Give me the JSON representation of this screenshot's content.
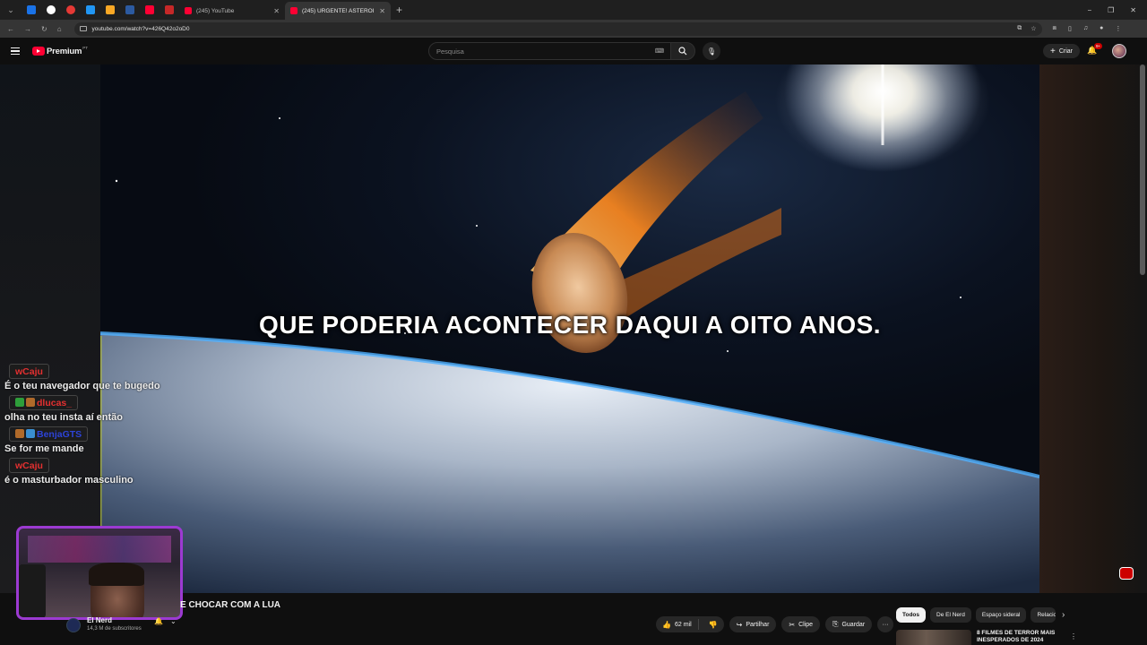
{
  "browser": {
    "tabs": [
      {
        "title": "(245) YouTube",
        "active": false
      },
      {
        "title": "(245) URGENTE! ASTERÓIDE V...",
        "active": true
      }
    ],
    "new_tab_icon": "plus-icon",
    "window_controls": [
      "−",
      "❐",
      "✕"
    ],
    "url": "youtube.com/watch?v=426Q42o2oD0",
    "pinned_colors": [
      "#1a73e8",
      "#ffffff",
      "#e53935",
      "#2196f3",
      "#f9a825",
      "#2c5aa0",
      "#ff0033",
      "#c62828"
    ]
  },
  "masthead": {
    "logo_text": "Premium",
    "country_code": "PT",
    "search_placeholder": "Pesquisa",
    "create_label": "Criar",
    "notifications_badge": "9+"
  },
  "video": {
    "subtitle": "QUE PODERIA ACONTECER DAQUI A OITO ANOS.",
    "title_partial": "E CHOCAR COM A LUA",
    "channel_name": "El Nerd",
    "subscribers": "14,3 M de subscritores"
  },
  "chat": [
    {
      "user": "wCaju",
      "color": "#e43030",
      "message": "É o teu navegador que te bugedo",
      "emotes": 0
    },
    {
      "user": "dlucas_",
      "color": "#e43030",
      "message": "olha no teu insta aí então",
      "emotes": 2
    },
    {
      "user": "BenjaGTS",
      "color": "#2d43d8",
      "message": "Se for me mande",
      "emotes": 2
    },
    {
      "user": "wCaju",
      "color": "#e43030",
      "message": "é o masturbador masculino",
      "emotes": 0
    }
  ],
  "actions": {
    "likes": "62 mil",
    "share": "Partilhar",
    "clip": "Clipe",
    "save": "Guardar",
    "more": "···"
  },
  "related_chips": [
    "Todos",
    "De El Nerd",
    "Espaço sideral",
    "Relacio"
  ],
  "recommendation": {
    "title_line1": "8 FILMES DE TERROR MAIS",
    "title_line2": "INESPERADOS DE 2024"
  },
  "colors": {
    "background": "#0f0f0f",
    "youtube_red": "#ff0033",
    "cam_border": "#9c3ad2"
  }
}
